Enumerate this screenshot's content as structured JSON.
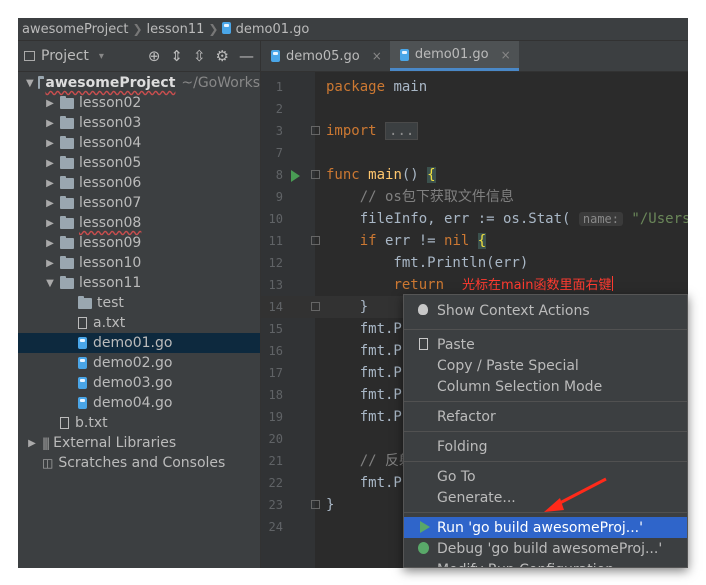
{
  "breadcrumb": {
    "project": "awesomeProject",
    "folder": "lesson11",
    "file": "demo01.go"
  },
  "project_panel": {
    "title": "Project",
    "tree": [
      {
        "label": "awesomeProject",
        "extra": "~/GoWorks",
        "depth": 0,
        "kind": "folder",
        "expanded": true,
        "root": true
      },
      {
        "label": "lesson02",
        "depth": 1,
        "kind": "folder",
        "expanded": false
      },
      {
        "label": "lesson03",
        "depth": 1,
        "kind": "folder",
        "expanded": false
      },
      {
        "label": "lesson04",
        "depth": 1,
        "kind": "folder",
        "expanded": false
      },
      {
        "label": "lesson05",
        "depth": 1,
        "kind": "folder",
        "expanded": false
      },
      {
        "label": "lesson06",
        "depth": 1,
        "kind": "folder",
        "expanded": false
      },
      {
        "label": "lesson07",
        "depth": 1,
        "kind": "folder",
        "expanded": false
      },
      {
        "label": "lesson08",
        "depth": 1,
        "kind": "folder",
        "expanded": false,
        "error": true
      },
      {
        "label": "lesson09",
        "depth": 1,
        "kind": "folder",
        "expanded": false
      },
      {
        "label": "lesson10",
        "depth": 1,
        "kind": "folder",
        "expanded": false
      },
      {
        "label": "lesson11",
        "depth": 1,
        "kind": "folder",
        "expanded": true
      },
      {
        "label": "test",
        "depth": 2,
        "kind": "folder",
        "leaf": true
      },
      {
        "label": "a.txt",
        "depth": 2,
        "kind": "file",
        "leaf": true
      },
      {
        "label": "demo01.go",
        "depth": 2,
        "kind": "go",
        "leaf": true,
        "selected": true
      },
      {
        "label": "demo02.go",
        "depth": 2,
        "kind": "go",
        "leaf": true
      },
      {
        "label": "demo03.go",
        "depth": 2,
        "kind": "go",
        "leaf": true
      },
      {
        "label": "demo04.go",
        "depth": 2,
        "kind": "go",
        "leaf": true
      },
      {
        "label": "b.txt",
        "depth": 1,
        "kind": "file",
        "leaf": true
      },
      {
        "label": "External Libraries",
        "depth": 0,
        "kind": "lib",
        "expanded": false
      },
      {
        "label": "Scratches and Consoles",
        "depth": 0,
        "kind": "scratch",
        "leaf": true
      }
    ]
  },
  "tabs": [
    {
      "label": "demo05.go",
      "active": false
    },
    {
      "label": "demo01.go",
      "active": true
    }
  ],
  "editor": {
    "lines": [
      {
        "n": "1",
        "text": "package main"
      },
      {
        "n": "2",
        "text": ""
      },
      {
        "n": "3",
        "text": "import ..."
      },
      {
        "n": "7",
        "text": ""
      },
      {
        "n": "8",
        "text": "func main() {"
      },
      {
        "n": "9",
        "text": "    // os包下获取文件信息"
      },
      {
        "n": "10",
        "text": "    fileInfo, err := os.Stat(",
        "hint": "name:",
        "rest": " \"/Users/xj"
      },
      {
        "n": "11",
        "text": "    if err != nil {"
      },
      {
        "n": "12",
        "text": "        fmt.Println(err)"
      },
      {
        "n": "13",
        "text": "        return",
        "annotation": "光标在main函数里面右键"
      },
      {
        "n": "14",
        "text": "    }"
      },
      {
        "n": "15",
        "text": "    fmt.Pr"
      },
      {
        "n": "16",
        "text": "    fmt.Pr"
      },
      {
        "n": "17",
        "text": "    fmt.Pr"
      },
      {
        "n": "18",
        "text": "    fmt.Pr"
      },
      {
        "n": "19",
        "text": "    fmt.Pr"
      },
      {
        "n": "20",
        "text": ""
      },
      {
        "n": "21",
        "text": "    // 反射"
      },
      {
        "n": "22",
        "text": "    fmt.Pr"
      },
      {
        "n": "23",
        "text": "}"
      },
      {
        "n": "24",
        "text": ""
      }
    ]
  },
  "context_menu": {
    "items": [
      {
        "label": "Show Context Actions",
        "icon": "bulb-icon"
      },
      {
        "sep": true
      },
      {
        "label": "Paste",
        "icon": "clipboard-icon"
      },
      {
        "label": "Copy / Paste Special"
      },
      {
        "label": "Column Selection Mode"
      },
      {
        "sep": true
      },
      {
        "label": "Refactor"
      },
      {
        "sep": true
      },
      {
        "label": "Folding"
      },
      {
        "sep": true
      },
      {
        "label": "Go To"
      },
      {
        "label": "Generate..."
      },
      {
        "sep": true
      },
      {
        "label": "Run 'go build awesomeProj...'",
        "icon": "run-icon",
        "selected": true
      },
      {
        "label": "Debug 'go build awesomeProj...'",
        "icon": "debug-icon"
      },
      {
        "label": "Modify Run Configuration..."
      }
    ]
  },
  "colors": {
    "accent_selected": "#2f65ca",
    "annotation": "#ff3b30",
    "background": "#2b2b2b"
  }
}
